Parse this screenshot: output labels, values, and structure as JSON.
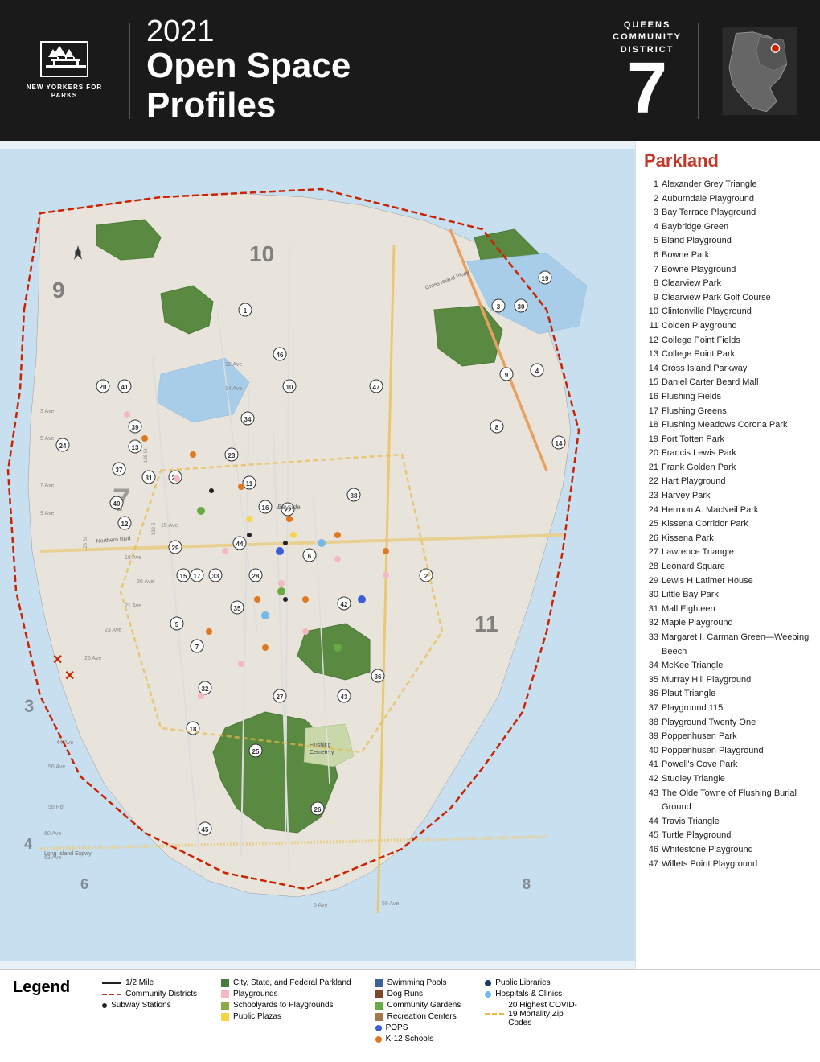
{
  "header": {
    "year": "2021",
    "title_line1": "Open Space",
    "title_line2": "Profiles",
    "borough": "QUEENS",
    "district_label": "COMMUNITY\nDISTRICT",
    "district_number": "7",
    "logo_org": "NEW YORKERS\nFOR PARKS"
  },
  "sidebar": {
    "title": "Parkland",
    "parks": [
      {
        "num": "1",
        "name": "Alexander Grey Triangle"
      },
      {
        "num": "2",
        "name": "Auburndale Playground"
      },
      {
        "num": "3",
        "name": "Bay Terrace Playground"
      },
      {
        "num": "4",
        "name": "Baybridge Green"
      },
      {
        "num": "5",
        "name": "Bland Playground"
      },
      {
        "num": "6",
        "name": "Bowne Park"
      },
      {
        "num": "7",
        "name": "Bowne Playground"
      },
      {
        "num": "8",
        "name": "Clearview Park"
      },
      {
        "num": "9",
        "name": "Clearview Park Golf Course"
      },
      {
        "num": "10",
        "name": "Clintonville Playground"
      },
      {
        "num": "11",
        "name": "Colden Playground"
      },
      {
        "num": "12",
        "name": "College Point Fields"
      },
      {
        "num": "13",
        "name": "College Point Park"
      },
      {
        "num": "14",
        "name": "Cross Island Parkway"
      },
      {
        "num": "15",
        "name": "Daniel Carter Beard Mall"
      },
      {
        "num": "16",
        "name": "Flushing Fields"
      },
      {
        "num": "17",
        "name": "Flushing Greens"
      },
      {
        "num": "18",
        "name": "Flushing Meadows Corona Park"
      },
      {
        "num": "19",
        "name": "Fort Totten Park"
      },
      {
        "num": "20",
        "name": "Francis Lewis Park"
      },
      {
        "num": "21",
        "name": "Frank Golden Park"
      },
      {
        "num": "22",
        "name": "Hart Playground"
      },
      {
        "num": "23",
        "name": "Harvey Park"
      },
      {
        "num": "24",
        "name": "Hermon A. MacNeil Park"
      },
      {
        "num": "25",
        "name": "Kissena Corridor Park"
      },
      {
        "num": "26",
        "name": "Kissena Park"
      },
      {
        "num": "27",
        "name": "Lawrence Triangle"
      },
      {
        "num": "28",
        "name": "Leonard Square"
      },
      {
        "num": "29",
        "name": "Lewis H Latimer House"
      },
      {
        "num": "30",
        "name": "Little Bay Park"
      },
      {
        "num": "31",
        "name": "Mall Eighteen"
      },
      {
        "num": "32",
        "name": "Maple Playground"
      },
      {
        "num": "33",
        "name": "Margaret I. Carman Green—Weeping Beech"
      },
      {
        "num": "34",
        "name": "McKee Triangle"
      },
      {
        "num": "35",
        "name": "Murray Hill Playground"
      },
      {
        "num": "36",
        "name": "Plaut Triangle"
      },
      {
        "num": "37",
        "name": "Playground 115"
      },
      {
        "num": "38",
        "name": "Playground Twenty One"
      },
      {
        "num": "39",
        "name": "Poppenhusen Park"
      },
      {
        "num": "40",
        "name": "Poppenhusen Playground"
      },
      {
        "num": "41",
        "name": "Powell's Cove Park"
      },
      {
        "num": "42",
        "name": "Studley Triangle"
      },
      {
        "num": "43",
        "name": "The Olde Towne of Flushing Burial Ground"
      },
      {
        "num": "44",
        "name": "Travis Triangle"
      },
      {
        "num": "45",
        "name": "Turtle Playground"
      },
      {
        "num": "46",
        "name": "Whitestone Playground"
      },
      {
        "num": "47",
        "name": "Willets Point Playground"
      }
    ]
  },
  "legend": {
    "title": "Legend",
    "items_col1": [
      {
        "type": "line",
        "label": "1/2 Mile"
      },
      {
        "type": "dash_red",
        "label": "Community Districts"
      },
      {
        "type": "dot",
        "label": "Subway Stations"
      }
    ],
    "items_col2": [
      {
        "type": "sq_green",
        "label": "City, State, and Federal Parkland"
      },
      {
        "type": "sq_pink",
        "label": "Playgrounds"
      },
      {
        "type": "sq_olive",
        "label": "Schoolyards to Playgrounds"
      },
      {
        "type": "sq_yellow",
        "label": "Public Plazas"
      }
    ],
    "items_col3": [
      {
        "type": "sq_blue",
        "label": "Swimming Pools"
      },
      {
        "type": "sq_brown",
        "label": "Dog Runs"
      },
      {
        "type": "sq_lgreen",
        "label": "Community Gardens"
      },
      {
        "type": "sq_orange",
        "label": "Recreation Centers"
      },
      {
        "type": "dot_blue",
        "label": "POPS"
      },
      {
        "type": "dot_orange",
        "label": "K-12 Schools"
      }
    ],
    "items_col4": [
      {
        "type": "dot_darkblue",
        "label": "Public Libraries"
      },
      {
        "type": "dot_lblue",
        "label": "Hospitals & Clinics"
      },
      {
        "type": "dash_yellow",
        "label": "20 Highest COVID-19 Mortality Zip Codes"
      }
    ]
  }
}
